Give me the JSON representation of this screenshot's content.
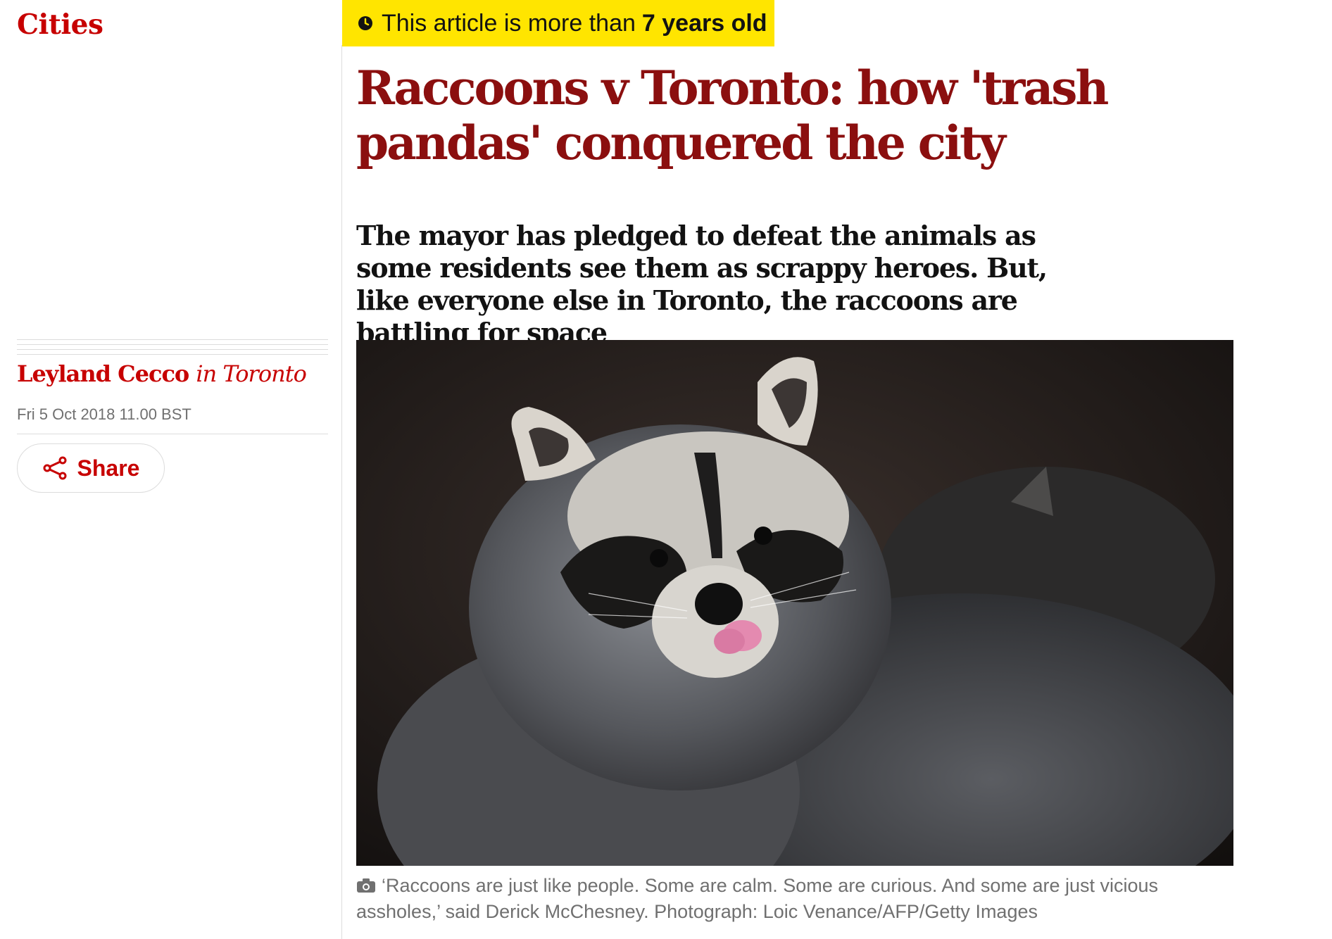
{
  "section": {
    "label": "Cities"
  },
  "age_banner": {
    "text": "This article is more than",
    "years": "7 years old",
    "icon": "clock-icon"
  },
  "headline": "Raccoons v Toronto: how 'trash pandas' conquered the city",
  "standfirst": "The mayor has pledged to defeat the animals as some residents see them as scrappy heroes. But, like everyone else in Toronto, the raccoons are battling for space",
  "byline": {
    "author": "Leyland Cecco",
    "location": "in Toronto"
  },
  "dateline": "Fri 5 Oct 2018 11.00 BST",
  "share": {
    "label": "Share",
    "icon": "share-icon"
  },
  "main_image": {
    "subject": "raccoon"
  },
  "caption": {
    "icon": "camera-icon",
    "text": "‘Raccoons are just like people. Some are calm. Some are curious. And some are just vicious assholes,’ said Derick McChesney. Photograph: Loic Venance/AFP/Getty Images"
  },
  "colors": {
    "section_red": "#c70000",
    "headline_red": "#8b0f0f",
    "banner_yellow": "#ffe500",
    "caption_grey": "#707070",
    "rule_grey": "#dcdcdc"
  }
}
